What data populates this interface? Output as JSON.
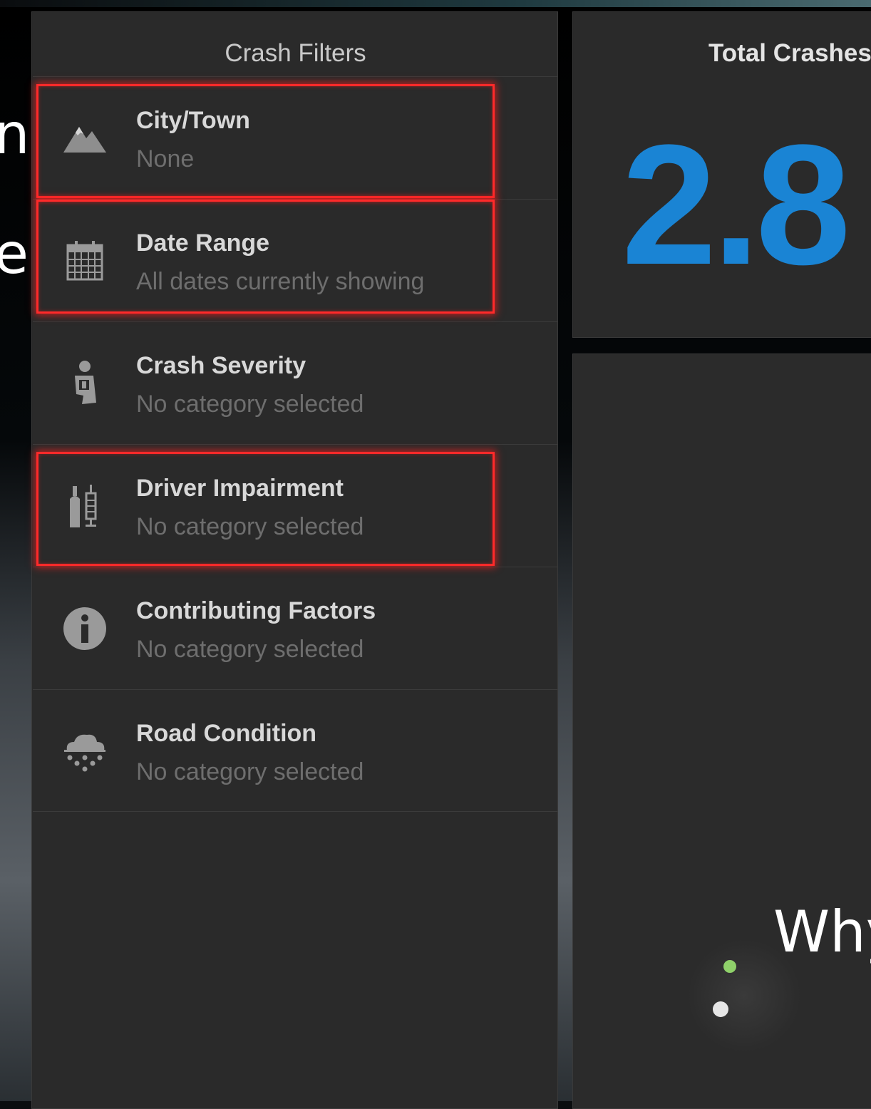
{
  "filters_panel": {
    "title": "Crash Filters",
    "items": [
      {
        "name": "city-town",
        "label": "City/Town",
        "value": "None",
        "icon": "mountain-icon"
      },
      {
        "name": "date-range",
        "label": "Date Range",
        "value": "All dates currently showing",
        "icon": "calendar-icon"
      },
      {
        "name": "crash-severity",
        "label": "Crash Severity",
        "value": "No category selected",
        "icon": "person-injury-icon"
      },
      {
        "name": "driver-impairment",
        "label": "Driver Impairment",
        "value": "No category selected",
        "icon": "bottles-icon"
      },
      {
        "name": "contributing-factors",
        "label": "Contributing Factors",
        "value": "No category selected",
        "icon": "info-icon"
      },
      {
        "name": "road-condition",
        "label": "Road Condition",
        "value": "No category selected",
        "icon": "snow-cloud-icon"
      }
    ]
  },
  "total_panel": {
    "title": "Total Crashes",
    "value": "2.8"
  },
  "overlay": {
    "edge_letters": [
      "n",
      "e"
    ],
    "caption": "Why"
  },
  "colors": {
    "accent": "#1a84d4",
    "highlight": "#ff2a2a",
    "dot_green": "#8fd16a",
    "dot_white": "#e6e6e6"
  }
}
